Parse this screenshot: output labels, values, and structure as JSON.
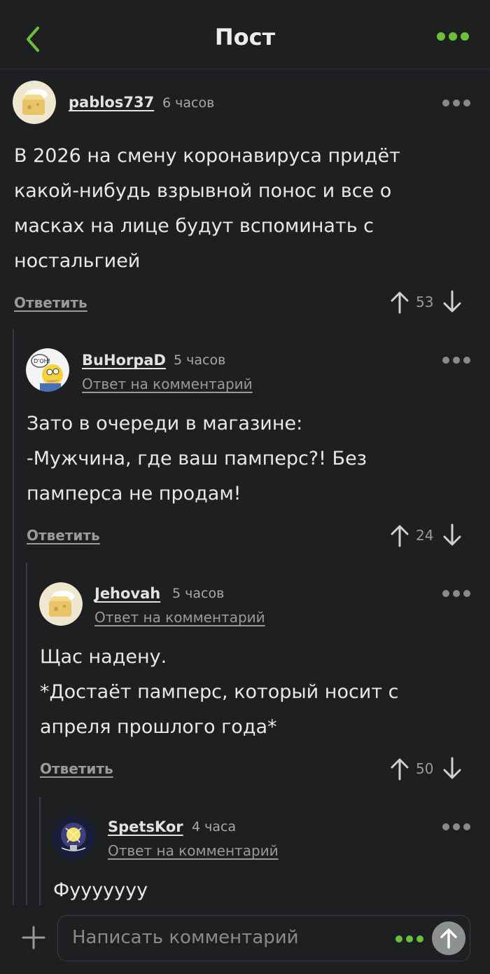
{
  "header": {
    "title": "Пост"
  },
  "post": {
    "author": "pablos737",
    "time": "6 часов",
    "text": "В 2026 на смену коронавируса придёт\nкакой-нибудь взрывной понос и все о\nмасках на лице будут вспоминать с\nностальгией",
    "reply_label": "Ответить",
    "votes": "53"
  },
  "comments": [
    {
      "author": "BuHorpaD",
      "time": "5 часов",
      "reply_to": "Ответ на комментарий",
      "text": "Зато в очереди в магазине:\n-Мужчина, где ваш памперс?! Без\nпамперса не продам!",
      "reply_label": "Ответить",
      "votes": "24"
    },
    {
      "author": "Jehovah",
      "time": "5 часов",
      "reply_to": "Ответ на комментарий",
      "text": "Щас надену.\n*Достаёт памперс, который носит с\nапреля прошлого года*",
      "reply_label": "Ответить",
      "votes": "50"
    },
    {
      "author": "SpetsKor",
      "time": "4 часа",
      "reply_to": "Ответ на комментарий",
      "text": "Фууууууу"
    }
  ],
  "composer": {
    "placeholder": "Написать комментарий"
  },
  "colors": {
    "accent": "#6cbf3a",
    "background": "#1e1f21"
  }
}
